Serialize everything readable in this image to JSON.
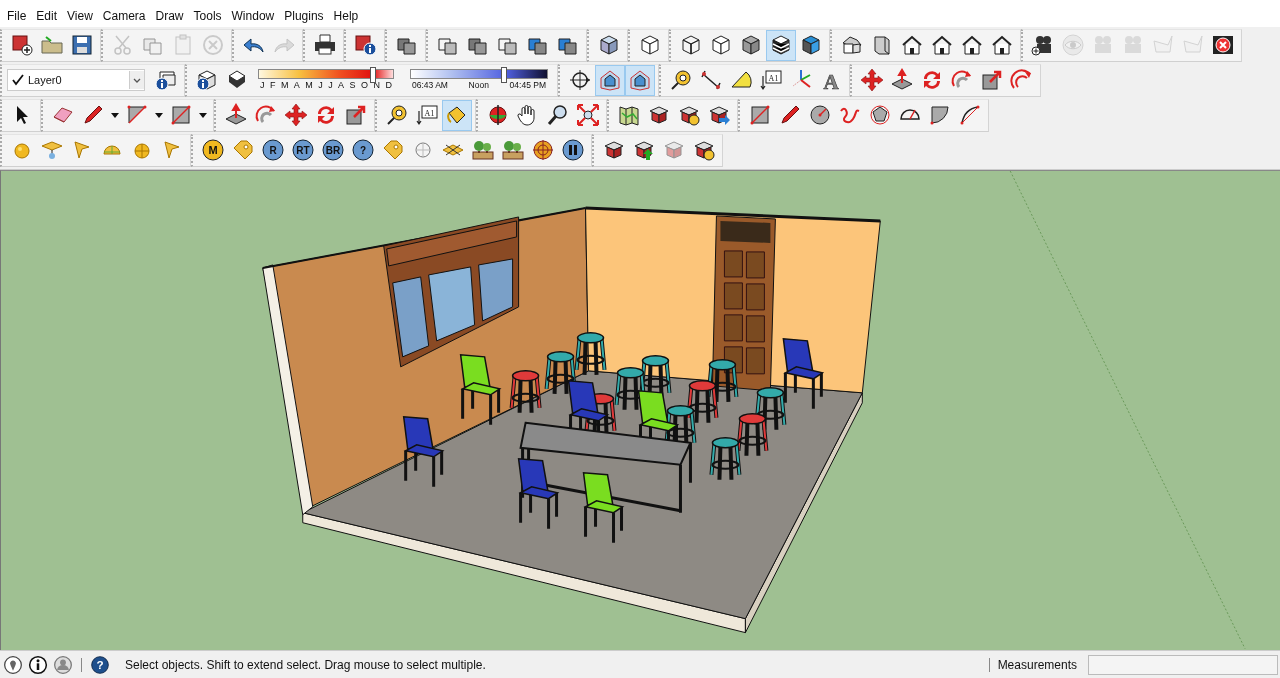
{
  "menu": [
    "File",
    "Edit",
    "View",
    "Camera",
    "Draw",
    "Tools",
    "Window",
    "Plugins",
    "Help"
  ],
  "toolbars": [
    {
      "groups": [
        [
          {
            "kind": "new-model",
            "selected": false,
            "disabled": false
          },
          {
            "kind": "folder",
            "selected": false,
            "disabled": false
          },
          {
            "kind": "floppy-disk",
            "selected": false,
            "disabled": false
          }
        ],
        [
          {
            "kind": "scissors",
            "selected": false,
            "disabled": true
          },
          {
            "kind": "copy",
            "selected": false,
            "disabled": true
          },
          {
            "kind": "paste",
            "selected": false,
            "disabled": true
          },
          {
            "kind": "erase-circle",
            "selected": false,
            "disabled": true
          }
        ],
        [
          {
            "kind": "undo",
            "selected": false,
            "disabled": false
          },
          {
            "kind": "redo",
            "selected": false,
            "disabled": true
          }
        ],
        [
          {
            "kind": "printer",
            "selected": false,
            "disabled": false
          }
        ],
        [
          {
            "kind": "model-info",
            "selected": false,
            "disabled": false
          }
        ],
        [
          {
            "kind": "stacked-boxes",
            "selected": false,
            "disabled": false
          }
        ],
        [
          {
            "kind": "wire-boxes",
            "selected": false,
            "disabled": false
          },
          {
            "kind": "stacked-boxes",
            "selected": false,
            "disabled": false
          },
          {
            "kind": "wire-boxes",
            "selected": false,
            "disabled": false
          },
          {
            "kind": "shaded-boxes",
            "selected": false,
            "disabled": false
          },
          {
            "kind": "shaded-boxes",
            "selected": false,
            "disabled": false
          }
        ],
        [
          {
            "kind": "iso-cube",
            "selected": false,
            "disabled": false
          }
        ],
        [
          {
            "kind": "cube-outline",
            "selected": false,
            "disabled": false
          }
        ],
        [
          {
            "kind": "wire-cube",
            "selected": false,
            "disabled": false
          },
          {
            "kind": "cube-outline",
            "selected": false,
            "disabled": false
          },
          {
            "kind": "shaded-cube",
            "selected": false,
            "disabled": false
          },
          {
            "kind": "striped-cube",
            "selected": true,
            "disabled": false
          },
          {
            "kind": "textured-cube",
            "selected": false,
            "disabled": false
          }
        ],
        [
          {
            "kind": "house-iso",
            "selected": false,
            "disabled": false
          },
          {
            "kind": "box-front",
            "selected": false,
            "disabled": false
          },
          {
            "kind": "house",
            "selected": false,
            "disabled": false
          },
          {
            "kind": "house",
            "selected": false,
            "disabled": false
          },
          {
            "kind": "house",
            "selected": false,
            "disabled": false
          },
          {
            "kind": "house",
            "selected": false,
            "disabled": false
          }
        ],
        [
          {
            "kind": "camera-add",
            "selected": false,
            "disabled": false
          },
          {
            "kind": "eye",
            "selected": false,
            "disabled": true
          },
          {
            "kind": "camera",
            "selected": false,
            "disabled": true
          },
          {
            "kind": "camera",
            "selected": false,
            "disabled": true
          },
          {
            "kind": "plane",
            "selected": false,
            "disabled": true
          },
          {
            "kind": "plane",
            "selected": false,
            "disabled": true
          },
          {
            "kind": "delete-x",
            "selected": false,
            "disabled": false
          }
        ]
      ]
    },
    {
      "groups": [
        [
          {
            "kind": "layer-select",
            "value": "Layer0",
            "checked": true
          },
          {
            "kind": "layer-info",
            "selected": false,
            "disabled": false
          }
        ],
        [
          {
            "kind": "info-cube",
            "selected": false,
            "disabled": false
          },
          {
            "kind": "shadow-cube",
            "selected": false,
            "disabled": false
          },
          {
            "kind": "month-slider",
            "months": [
              "J",
              "F",
              "M",
              "A",
              "M",
              "J",
              "J",
              "A",
              "S",
              "O",
              "N",
              "D"
            ],
            "level": 0.84
          },
          {
            "kind": "time-slider",
            "labels": [
              "06:43 AM",
              "Noon",
              "04:45 PM"
            ],
            "level": 0.68
          }
        ],
        [
          {
            "kind": "crosshair",
            "selected": false,
            "disabled": false
          },
          {
            "kind": "house-cube",
            "selected": true,
            "disabled": false
          },
          {
            "kind": "house-cube",
            "selected": true,
            "disabled": false
          }
        ],
        [
          {
            "kind": "tape-measure",
            "selected": false,
            "disabled": false
          },
          {
            "kind": "dimension",
            "selected": false,
            "disabled": false
          },
          {
            "kind": "protractor",
            "selected": false,
            "disabled": false
          },
          {
            "kind": "text-label",
            "label": "A1",
            "selected": false,
            "disabled": false
          },
          {
            "kind": "axes",
            "selected": false,
            "disabled": false
          },
          {
            "kind": "text-3d",
            "label": "A",
            "selected": false,
            "disabled": false
          }
        ],
        [
          {
            "kind": "move",
            "selected": false,
            "disabled": false
          },
          {
            "kind": "push-pull",
            "selected": false,
            "disabled": false
          },
          {
            "kind": "rotate",
            "selected": false,
            "disabled": false
          },
          {
            "kind": "follow-me",
            "selected": false,
            "disabled": false
          },
          {
            "kind": "scale",
            "selected": false,
            "disabled": false
          },
          {
            "kind": "offset",
            "selected": false,
            "disabled": false
          }
        ]
      ]
    },
    {
      "groups": [
        [
          {
            "kind": "cursor",
            "selected": false,
            "disabled": false
          }
        ],
        [
          {
            "kind": "eraser",
            "selected": false,
            "disabled": false
          },
          {
            "kind": "pencil",
            "selected": false,
            "disabled": false
          },
          {
            "kind": "caret",
            "selected": false,
            "disabled": false
          },
          {
            "kind": "arc-rectangle",
            "selected": false,
            "disabled": false
          },
          {
            "kind": "caret",
            "selected": false,
            "disabled": false
          },
          {
            "kind": "rectangle",
            "selected": false,
            "disabled": false
          },
          {
            "kind": "caret",
            "selected": false,
            "disabled": false
          }
        ],
        [
          {
            "kind": "push-pull",
            "selected": false,
            "disabled": false
          },
          {
            "kind": "follow-me",
            "selected": false,
            "disabled": false
          },
          {
            "kind": "move",
            "selected": false,
            "disabled": false
          },
          {
            "kind": "rotate",
            "selected": false,
            "disabled": false
          },
          {
            "kind": "scale",
            "selected": false,
            "disabled": false
          }
        ],
        [
          {
            "kind": "tape-measure",
            "selected": false,
            "disabled": false
          },
          {
            "kind": "text-label",
            "label": "A1",
            "selected": false,
            "disabled": false
          },
          {
            "kind": "paint-bucket",
            "selected": true,
            "disabled": false
          }
        ],
        [
          {
            "kind": "orbit",
            "selected": false,
            "disabled": false
          },
          {
            "kind": "hand",
            "selected": false,
            "disabled": false
          },
          {
            "kind": "search",
            "selected": false,
            "disabled": false
          },
          {
            "kind": "zoom-extents",
            "selected": false,
            "disabled": false
          }
        ],
        [
          {
            "kind": "map",
            "selected": false,
            "disabled": false
          },
          {
            "kind": "warehouse",
            "selected": false,
            "disabled": false
          },
          {
            "kind": "warehouse-sync",
            "selected": false,
            "disabled": false
          },
          {
            "kind": "warehouse-export",
            "selected": false,
            "disabled": false
          }
        ],
        [
          {
            "kind": "rectangle",
            "selected": false,
            "disabled": false
          },
          {
            "kind": "pencil",
            "selected": false,
            "disabled": false
          },
          {
            "kind": "circle",
            "selected": false,
            "disabled": false
          },
          {
            "kind": "freehand",
            "selected": false,
            "disabled": false
          },
          {
            "kind": "polygon",
            "selected": false,
            "disabled": false
          },
          {
            "kind": "arc",
            "selected": false,
            "disabled": false
          },
          {
            "kind": "pie",
            "selected": false,
            "disabled": false
          },
          {
            "kind": "arc-open",
            "selected": false,
            "disabled": false
          }
        ]
      ]
    },
    {
      "groups": [
        [
          {
            "kind": "sphere",
            "selected": false,
            "disabled": false
          },
          {
            "kind": "plane-point",
            "selected": false,
            "disabled": false
          },
          {
            "kind": "flag",
            "selected": false,
            "disabled": false
          },
          {
            "kind": "half-sphere",
            "selected": false,
            "disabled": false
          },
          {
            "kind": "sphere-grid",
            "selected": false,
            "disabled": false
          },
          {
            "kind": "flag",
            "selected": false,
            "disabled": false
          }
        ],
        [
          {
            "kind": "medal",
            "label": "M",
            "selected": false,
            "disabled": false
          },
          {
            "kind": "tag",
            "selected": false,
            "disabled": false
          },
          {
            "kind": "letter-badge",
            "label": "R",
            "selected": false,
            "disabled": false
          },
          {
            "kind": "letter-badge",
            "label": "RT",
            "selected": false,
            "disabled": false
          },
          {
            "kind": "letter-badge",
            "label": "BR",
            "selected": false,
            "disabled": false
          },
          {
            "kind": "letter-badge",
            "label": "?",
            "selected": false,
            "disabled": false
          },
          {
            "kind": "tag",
            "selected": false,
            "disabled": false
          },
          {
            "kind": "wire-sphere",
            "selected": false,
            "disabled": false
          },
          {
            "kind": "cross-plane",
            "selected": false,
            "disabled": false
          },
          {
            "kind": "landscape",
            "selected": false,
            "disabled": false
          },
          {
            "kind": "landscape",
            "selected": false,
            "disabled": false
          },
          {
            "kind": "target",
            "selected": false,
            "disabled": false
          },
          {
            "kind": "pause",
            "selected": false,
            "disabled": false
          }
        ],
        [
          {
            "kind": "warehouse",
            "selected": false,
            "disabled": false
          },
          {
            "kind": "warehouse-upload",
            "selected": false,
            "disabled": false
          },
          {
            "kind": "warehouse",
            "selected": false,
            "disabled": true
          },
          {
            "kind": "warehouse-sync",
            "selected": false,
            "disabled": false
          }
        ]
      ]
    }
  ],
  "status_bar": {
    "icons": [
      {
        "kind": "location-pin"
      },
      {
        "kind": "info"
      },
      {
        "kind": "user"
      }
    ],
    "help": {
      "label": "?"
    },
    "message": "Select objects. Shift to extend select. Drag mouse to select multiple.",
    "measurements_label": "Measurements"
  }
}
